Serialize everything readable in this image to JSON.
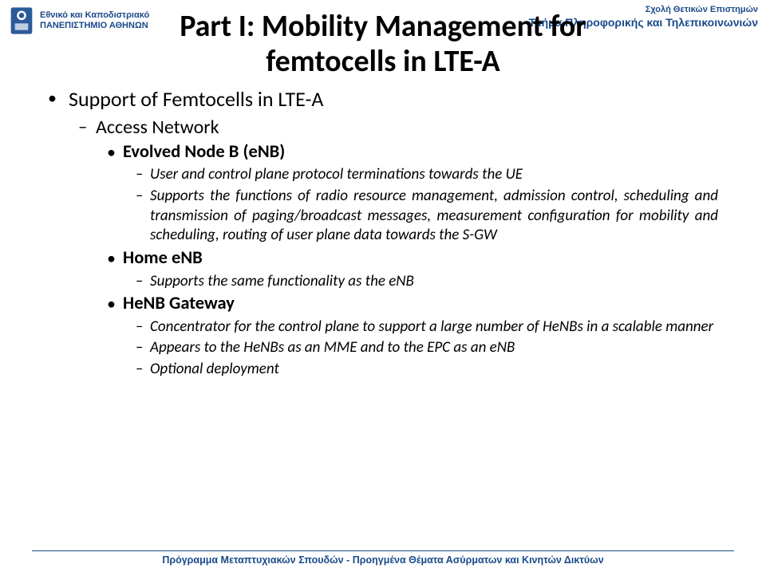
{
  "header": {
    "uni_line1": "Εθνικό και Καποδιστριακό",
    "uni_line2": "ΠΑΝΕΠΙΣΤΗΜΙΟ ΑΘΗΝΩΝ",
    "school": "Σχολή Θετικών Επιστημών",
    "department": "Τμήμα Πληροφορικής και Τηλεπικοινωνιών"
  },
  "title": {
    "line1": "Part I: Mobility Management for",
    "line2": "femtocells in LTE-A"
  },
  "content": {
    "b1": "Support of Femtocells in LTE-A",
    "b2": "Access Network",
    "b3a": "Evolved Node B (eNB)",
    "b4a1": "User and control plane protocol terminations towards the UE",
    "b4a2": "Supports the functions of radio resource management, admission control, scheduling and transmission of paging/broadcast messages, measurement configuration for mobility and scheduling, routing of user plane data towards the S-GW",
    "b3b": "Home eNB",
    "b4b1": "Supports the same functionality as the eNB",
    "b3c": "HeNB Gateway",
    "b4c1": "Concentrator for the control plane to support a large number of HeNBs in a scalable manner",
    "b4c2": "Appears to the HeNBs as an MME and to the EPC as an eNB",
    "b4c3": "Optional deployment"
  },
  "footer": "Πρόγραμμα Μεταπτυχιακών Σπουδών - Προηγμένα Θέματα Ασύρματων και Κινητών Δικτύων"
}
